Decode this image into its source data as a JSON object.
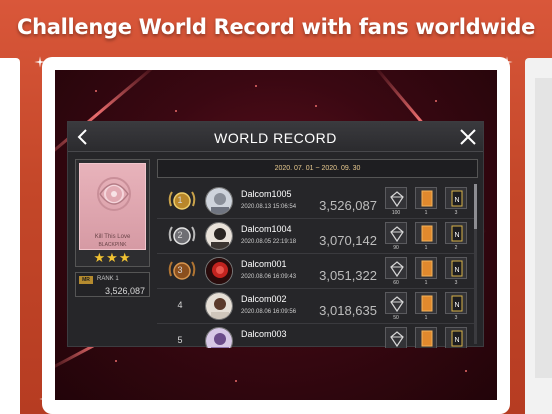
{
  "headline": "Challenge World Record with fans worldwide",
  "colors": {
    "accent": "#d9573a",
    "gold": "#e7c98f",
    "panel": "#262629",
    "star": "#f1c232"
  },
  "dialog": {
    "title": "WORLD RECORD",
    "back_icon": "chevron-left-icon",
    "close_icon": "close-icon",
    "period": "2020. 07. 01 ~ 2020. 09. 30"
  },
  "song": {
    "title": "Kill This Love",
    "artist": "BLACKPINK",
    "stars": "★★★",
    "my_rank_badge": "MR",
    "my_rank_label": "RANK",
    "my_rank_value": "1",
    "my_score": "3,526,087"
  },
  "records": [
    {
      "rank": "1",
      "medal": "gold",
      "name": "Dalcom1005",
      "date": "2020.08.13 15:06:54",
      "score": "3,526,087",
      "items": [
        "100",
        "1",
        "3"
      ]
    },
    {
      "rank": "2",
      "medal": "silver",
      "name": "Dalcom1004",
      "date": "2020.08.05 22:19:18",
      "score": "3,070,142",
      "items": [
        "90",
        "1",
        "2"
      ]
    },
    {
      "rank": "3",
      "medal": "bronze",
      "name": "Dalcom001",
      "date": "2020.08.06 16:09:43",
      "score": "3,051,322",
      "items": [
        "60",
        "1",
        "3"
      ]
    },
    {
      "rank": "4",
      "medal": "",
      "name": "Dalcom002",
      "date": "2020.08.06 16:09:56",
      "score": "3,018,635",
      "items": [
        "50",
        "1",
        "3"
      ]
    },
    {
      "rank": "5",
      "medal": "",
      "name": "Dalcom003",
      "date": "",
      "score": "",
      "items": [
        "",
        "",
        ""
      ]
    }
  ],
  "item_icons": [
    "diamond-icon",
    "card-icon",
    "n-card-icon"
  ]
}
